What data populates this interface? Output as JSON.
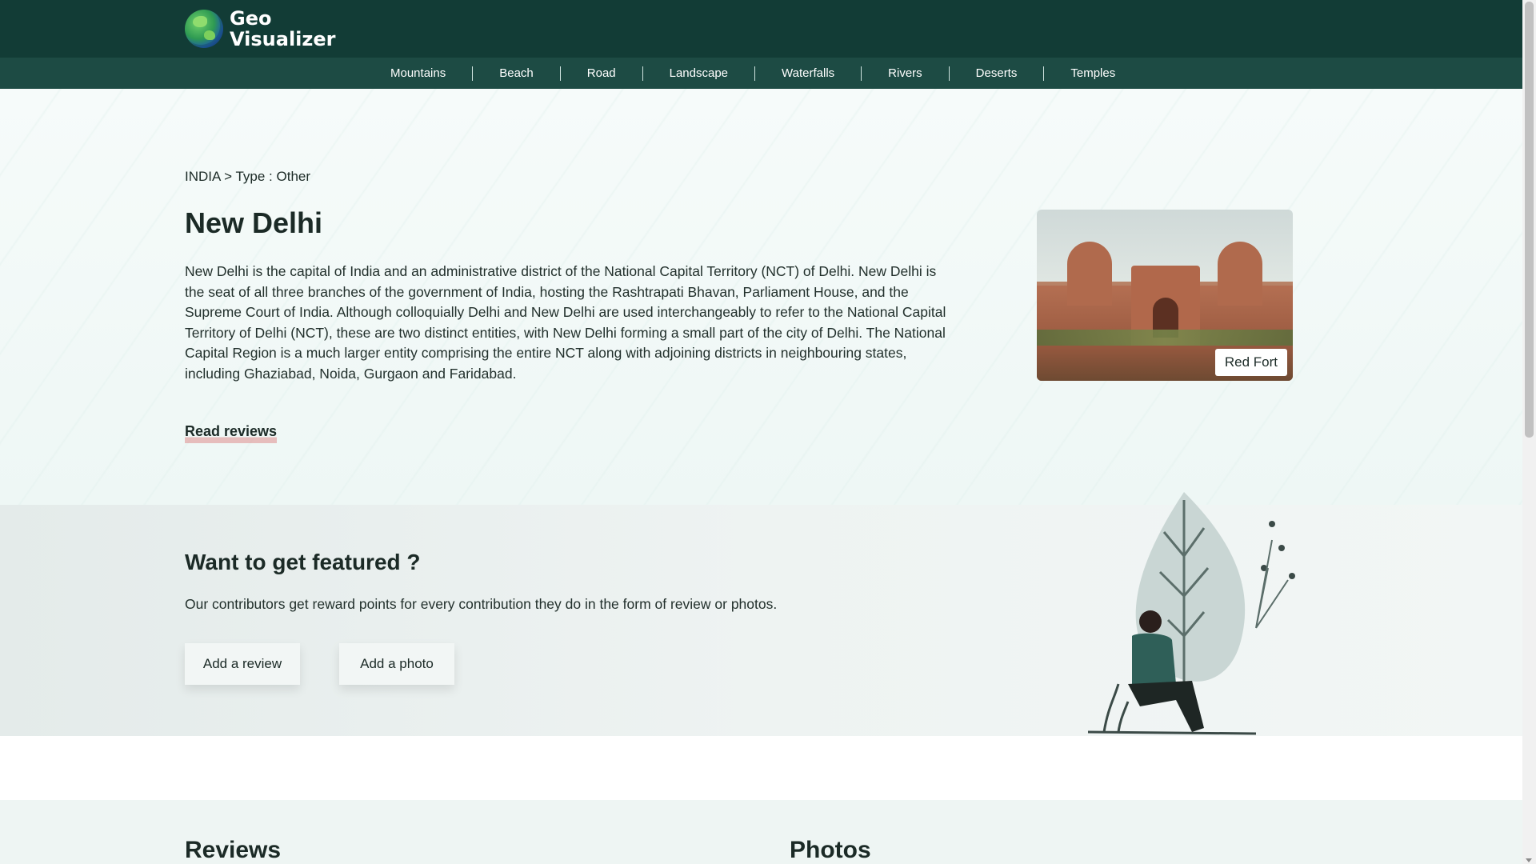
{
  "header": {
    "logo_line1": "Geo",
    "logo_line2": "Visualizer",
    "logo_icon": "globe-icon",
    "nav_items": [
      "Mountains",
      "Beach",
      "Road",
      "Landscape",
      "Waterfalls",
      "Rivers",
      "Deserts",
      "Temples"
    ]
  },
  "hero": {
    "breadcrumb": "INDIA > Type : Other",
    "title": "New Delhi",
    "description": "New Delhi is the capital of India and an administrative district of the National Capital Territory (NCT) of Delhi. New Delhi is the seat of all three branches of the government of India, hosting the Rashtrapati Bhavan, Parliament House, and the Supreme Court of India. Although colloquially Delhi and New Delhi are used interchangeably to refer to the National Capital Territory of Delhi (NCT), these are two distinct entities, with New Delhi forming a small part of the city of Delhi. The National Capital Region is a much larger entity comprising the entire NCT along with adjoining districts in neighbouring states, including Ghaziabad, Noida, Gurgaon and Faridabad.",
    "read_reviews": "Read reviews",
    "photo_caption": "Red Fort"
  },
  "featured": {
    "title": "Want to get featured ?",
    "text": "Our contributors get reward points for every contribution they do in the form of review or photos.",
    "add_review": "Add a review",
    "add_photo": "Add a photo"
  },
  "sections": {
    "reviews": "Reviews",
    "photos": "Photos"
  },
  "colors": {
    "header_bg": "#123c36",
    "nav_bg": "#1d4b44",
    "accent": "#d65050"
  }
}
